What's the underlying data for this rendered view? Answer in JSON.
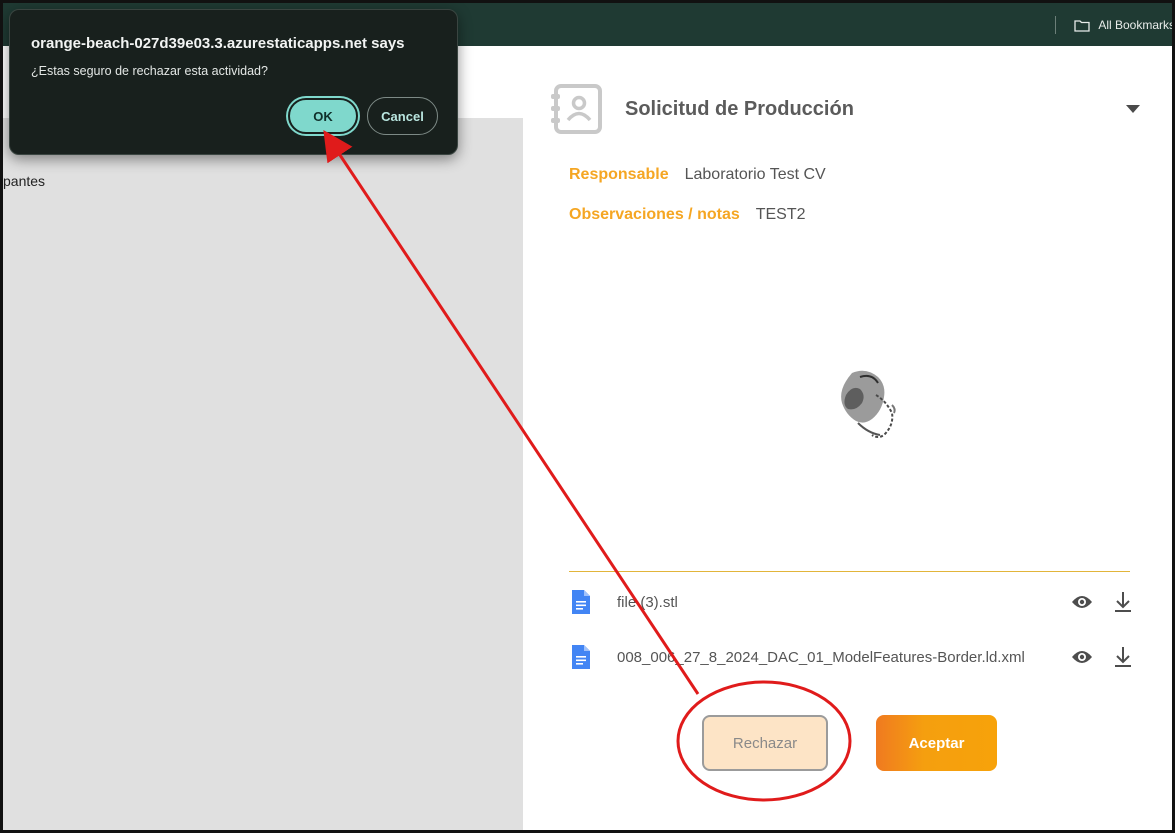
{
  "browser": {
    "bookmarks_label": "All Bookmarks",
    "bookmarks_icon": "folder-icon"
  },
  "left": {
    "partial_text": "pantes"
  },
  "panel": {
    "title": "Solicitud de Producción",
    "fields": [
      {
        "label": "Responsable",
        "value": "Laboratorio Test CV"
      },
      {
        "label": "Observaciones / notas",
        "value": "TEST2"
      }
    ],
    "files": [
      {
        "name": "file (3).stl"
      },
      {
        "name": "008_006_27_8_2024_DAC_01_ModelFeatures-Border.ld.xml"
      }
    ],
    "reject_label": "Rechazar",
    "accept_label": "Aceptar"
  },
  "dialog": {
    "title": "orange-beach-027d39e03.3.azurestaticapps.net says",
    "message": "¿Estas seguro de rechazar esta actividad?",
    "ok_label": "OK",
    "cancel_label": "Cancel"
  },
  "colors": {
    "accent_orange": "#f5a623",
    "dialog_bg": "#18201d",
    "ok_teal": "#7fd8cc",
    "annotation_red": "#e01b1b"
  }
}
